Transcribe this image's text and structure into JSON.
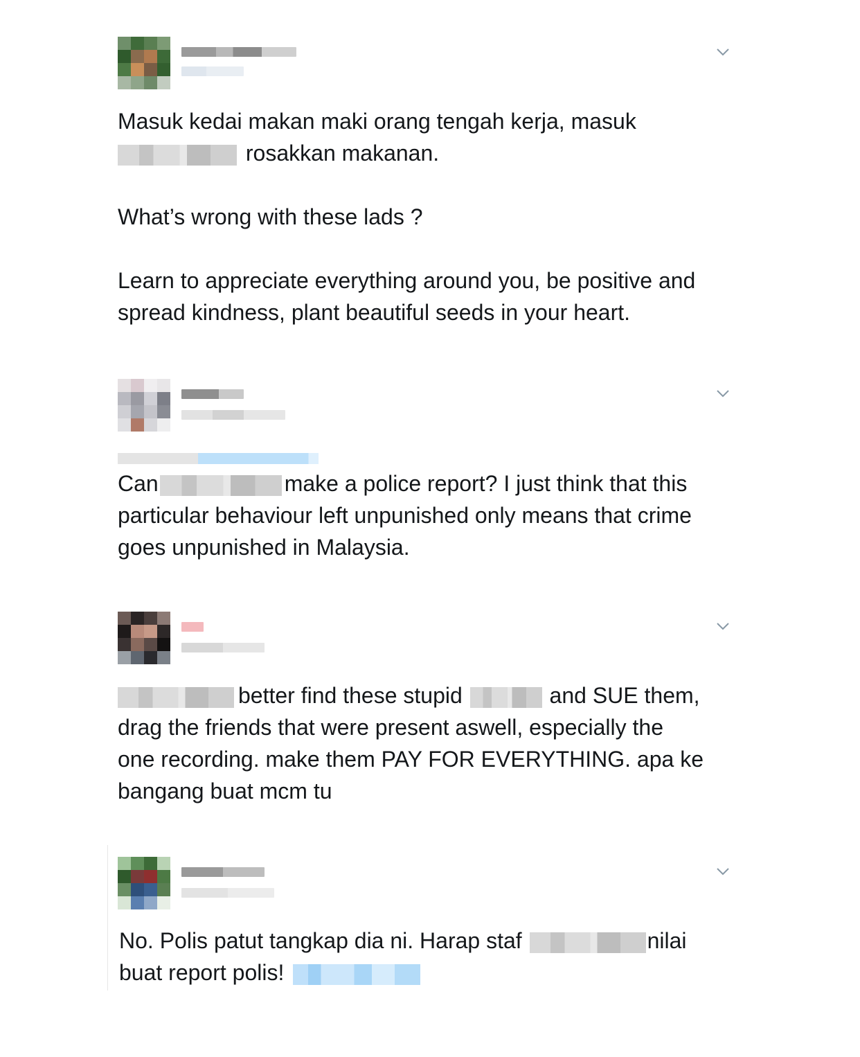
{
  "tweets": [
    {
      "text_parts": [
        "Masuk kedai makan maki orang tengah kerja, masuk\n",
        "[redacted]",
        " rosakkan makanan.\n\nWhat’s wrong with these lads ?\n\nLearn to appreciate everything around you, be positive and\nspread kindness, plant beautiful seeds in your heart."
      ],
      "avatar_colors": [
        "#6f8f6a",
        "#3f6b3a",
        "#5a7f52",
        "#7d9b75",
        "#2f5a2c",
        "#8a6b4e",
        "#b07a4f",
        "#3d6a38",
        "#4d7a45",
        "#c98f5a",
        "#7a5d45",
        "#335f2f",
        "#a8b8a4",
        "#8fa58a",
        "#6e8a69",
        "#c2ccc0"
      ]
    },
    {
      "text_parts": [
        "Can",
        "[redacted]",
        "make a police report? I just think that this\nparticular behaviour left unpunished only means that crime\ngoes unpunished in Malaysia."
      ],
      "avatar_colors": [
        "#e5e0e2",
        "#d9c9cf",
        "#f0eef0",
        "#e8e6e8",
        "#b9b9c0",
        "#9a9aa2",
        "#d0d0d6",
        "#7d7f88",
        "#cfcfd4",
        "#a5a6ae",
        "#c4c4ca",
        "#8a8c94",
        "#e0e0e3",
        "#b07a68",
        "#d6d6da",
        "#eeeeef"
      ]
    },
    {
      "text_parts": [
        "[redacted]",
        "better find these stupid ",
        "[redacted]",
        " and SUE them,\ndrag the friends that were present aswell, especially the\none recording. make them PAY FOR EVERYTHING. apa ke\nbangang buat mcm tu"
      ],
      "avatar_colors": [
        "#6b5a55",
        "#2a2424",
        "#4a3e3c",
        "#8c7a75",
        "#1e1a1a",
        "#b88a7a",
        "#c79a88",
        "#2d2828",
        "#3a3232",
        "#8a6a5e",
        "#5a4a46",
        "#141212",
        "#9aa0a6",
        "#5f6670",
        "#2a2a2e",
        "#7a8088"
      ]
    },
    {
      "text_parts": [
        "No. Polis patut tangkap dia ni. Harap staf ",
        "[redacted]",
        "nilai\nbuat report polis! ",
        "[redacted-link]"
      ],
      "avatar_colors": [
        "#9fc49a",
        "#5f8f5a",
        "#3d6b38",
        "#b9d3b4",
        "#2f5a2c",
        "#7a3a3a",
        "#8f2f2f",
        "#4d7a45",
        "#6a8f64",
        "#2e4f7a",
        "#3a5f8f",
        "#5a7f52",
        "#d9e6d6",
        "#5a7fb0",
        "#8fa8c8",
        "#e8efe6"
      ]
    }
  ],
  "icons": {
    "menu": "chevron-down-icon"
  },
  "colors": {
    "text": "#14171a",
    "chevron": "#8899a6",
    "link_blur": "#a9d6f7"
  }
}
